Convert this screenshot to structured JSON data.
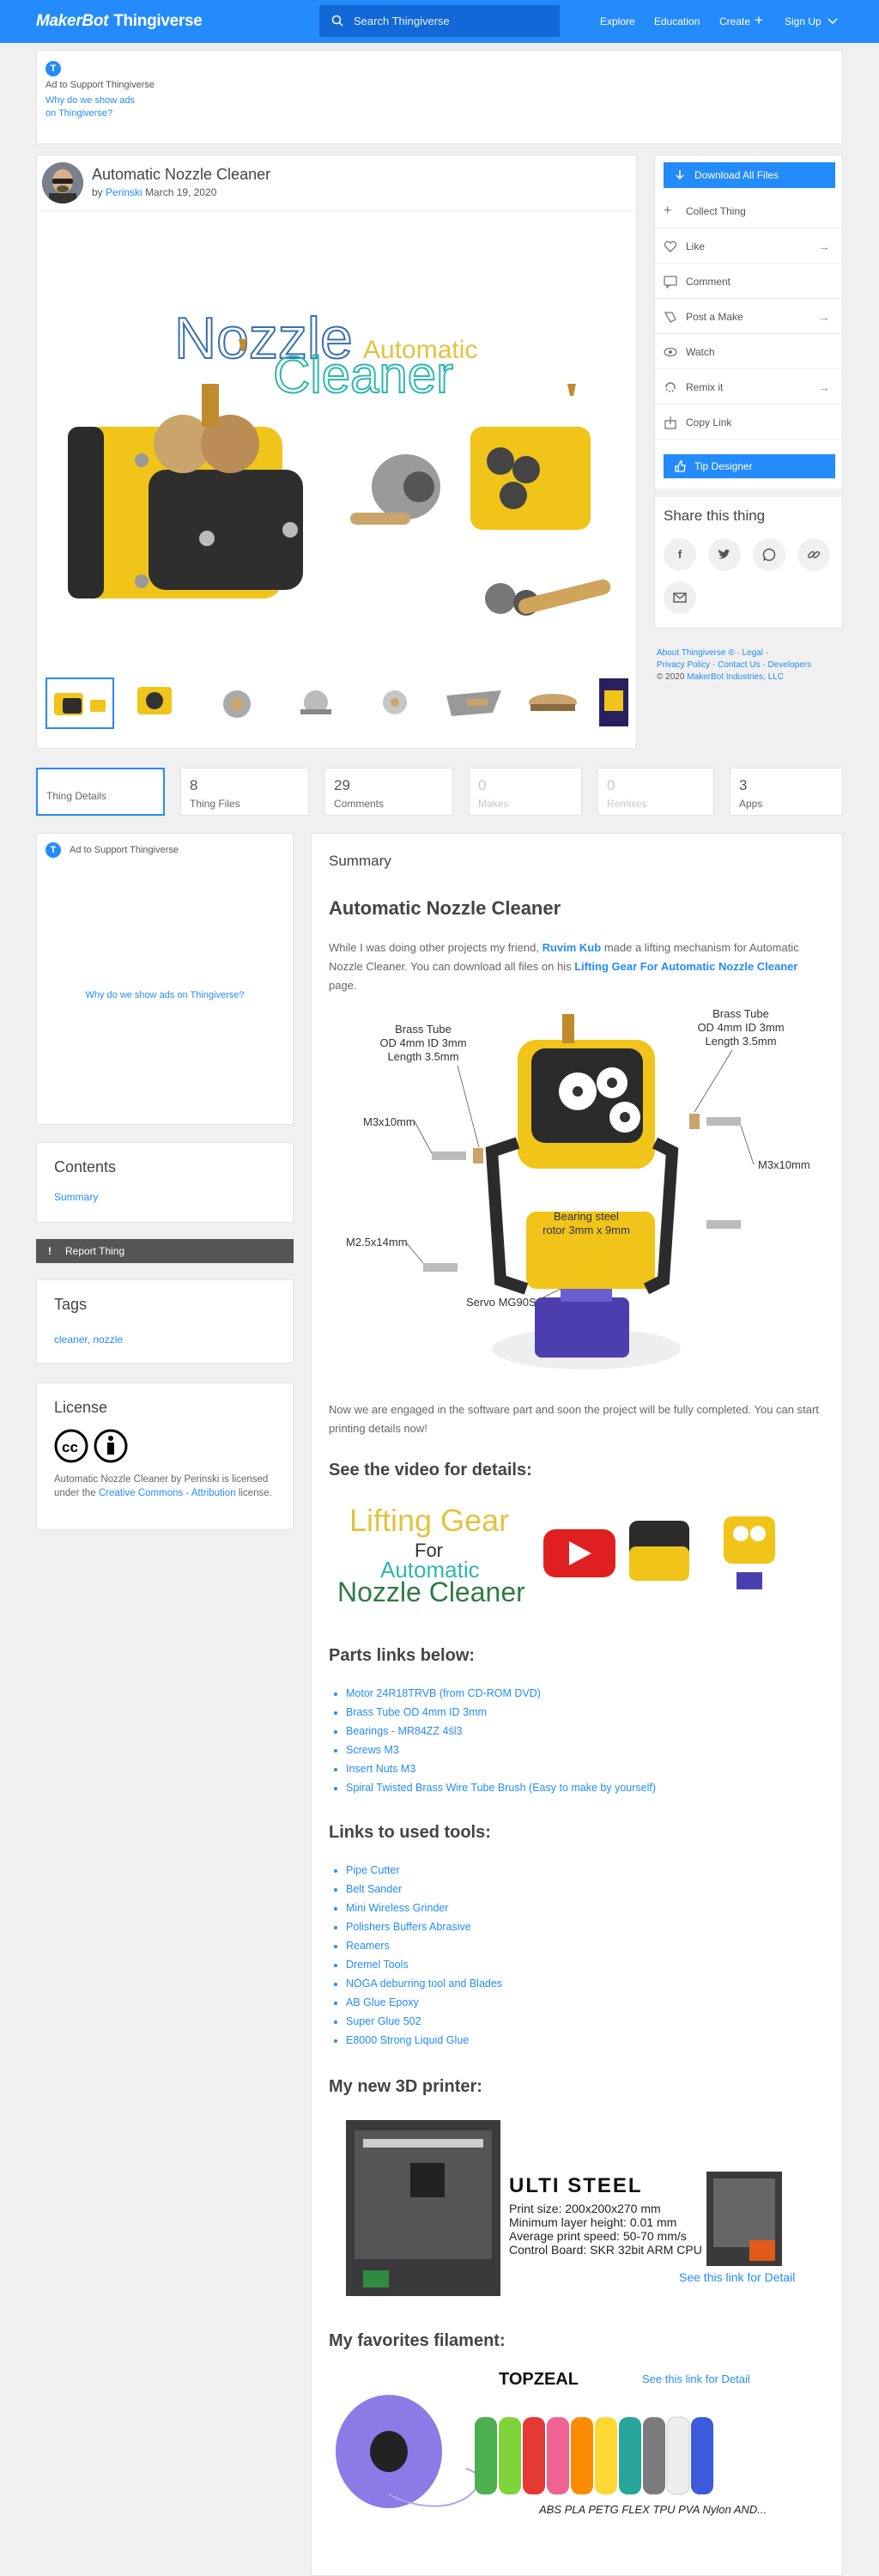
{
  "header": {
    "logo_prefix": "MakerBot",
    "logo_main": "Thingiverse",
    "search_placeholder": "Search Thingiverse",
    "nav": [
      "Explore",
      "Education",
      "Create",
      "Sign Up"
    ]
  },
  "top_ad": {
    "badge": "T",
    "title": "Ad to Support Thingiverse",
    "why_line1": "Why do we show ads",
    "why_line2": "on Thingiverse?"
  },
  "thing": {
    "title": "Automatic Nozzle Cleaner",
    "by": "by",
    "author": "Perinski",
    "date": "March 19, 2020",
    "hero_title_big": "Nozzle",
    "hero_title_small": "Automatic",
    "hero_title_second": "Cleaner"
  },
  "sidebar": {
    "download": "Download All Files",
    "actions": [
      "Collect Thing",
      "Like",
      "Comment",
      "Post a Make",
      "Watch",
      "Remix it",
      "Copy Link"
    ],
    "tip": "Tip Designer",
    "share_title": "Share this thing",
    "share_icons": [
      "facebook-icon",
      "twitter-icon",
      "whatsapp-icon",
      "link-icon",
      "email-icon"
    ]
  },
  "footer": {
    "about": "About Thingiverse ®",
    "legal": "Legal",
    "privacy": "Privacy Policy",
    "contact": "Contact Us",
    "developers": "Developers",
    "copyright": "© 2020",
    "company": "MakerBot Industries, LLC"
  },
  "tabs": [
    {
      "count": "",
      "label": "Thing Details"
    },
    {
      "count": "8",
      "label": "Thing Files"
    },
    {
      "count": "29",
      "label": "Comments"
    },
    {
      "count": "0",
      "label": "Makes"
    },
    {
      "count": "0",
      "label": "Remixes"
    },
    {
      "count": "3",
      "label": "Apps"
    }
  ],
  "left_ad": {
    "badge": "T",
    "title": "Ad to Support Thingiverse",
    "why": "Why do we show ads on Thingiverse?"
  },
  "contents": {
    "title": "Contents",
    "link": "Summary"
  },
  "report": "Report Thing",
  "tags": {
    "title": "Tags",
    "items": "cleaner, nozzle"
  },
  "license": {
    "title": "License",
    "text1": "Automatic Nozzle Cleaner by Perinski is licensed under the",
    "link": "Creative Commons - Attribution",
    "text2": "license."
  },
  "summary": {
    "heading": "Summary",
    "title": "Automatic Nozzle Cleaner",
    "intro_a": "While I was doing other projects my friend,",
    "friend": "Ruvim Kub",
    "intro_b": "made a lifting mechanism for Automatic Nozzle Cleaner. You can download all files on his",
    "lifting_link": "Lifting Gear For Automatic Nozzle Cleaner",
    "intro_c": "page.",
    "diagram_labels": {
      "brass_left": "Brass Tube",
      "brass_left_2": "OD 4mm ID 3mm",
      "brass_left_3": "Length 3.5mm",
      "brass_right": "Brass Tube",
      "brass_right_2": "OD 4mm ID 3mm",
      "brass_right_3": "Length 3.5mm",
      "m3_left": "M3x10mm",
      "m3_right": "M3x10mm",
      "bearing": "Bearing steel",
      "bearing_2": "rotor 3mm x 9mm",
      "m25": "M2.5x14mm",
      "servo": "Servo MG90S"
    },
    "software_note": "Now we are engaged in the software part and soon the project will be fully completed. You can start printing details now!",
    "video_heading": "See the video for details:",
    "video_lifting": "Lifting Gear",
    "video_for": "For",
    "video_automatic": "Automatic",
    "video_nozzle": "Nozzle Cleaner",
    "parts_heading": "Parts links below:",
    "parts": [
      "Motor 24R18TRVB (from CD-ROM DVD)",
      "Brass Tube OD 4mm ID 3mm",
      "Bearings - MR84ZZ 4śl3",
      "Screws M3",
      "Insert Nuts M3",
      "Spiral Twisted Brass Wire Tube Brush (Easy to make by yourself)"
    ],
    "tools_heading": "Links to used tools:",
    "tools": [
      "Pipe Cutter",
      "Belt Sander",
      "Mini Wireless Grinder",
      "Polishers Buffers Abrasive",
      "Reamers",
      "Dremel Tools",
      "NOGA deburring tool and Blades",
      "AB Glue Epoxy",
      "Super Glue 502",
      "E8000 Strong Liquid Glue"
    ],
    "printer_heading": "My new 3D printer:",
    "printer": {
      "name": "ULTI STEEL",
      "spec1": "Print size: 200x200x270 mm",
      "spec2": "Minimum layer height: 0.01 mm",
      "spec3": "Average print speed: 50-70 mm/s",
      "spec4": "Control Board: SKR 32bit ARM CPU",
      "link": "See this link for Detail"
    },
    "filament_heading": "My favorites filament:",
    "filament": {
      "brand": "TOPZEAL",
      "link": "See this link for Detail",
      "types": "ABS PLA PETG FLEX TPU PVA Nylon AND..."
    }
  },
  "colors": {
    "accent": "#248bfb",
    "header": "#248bfb",
    "yellow": "#f0c419",
    "dark": "#2b2b2b"
  }
}
